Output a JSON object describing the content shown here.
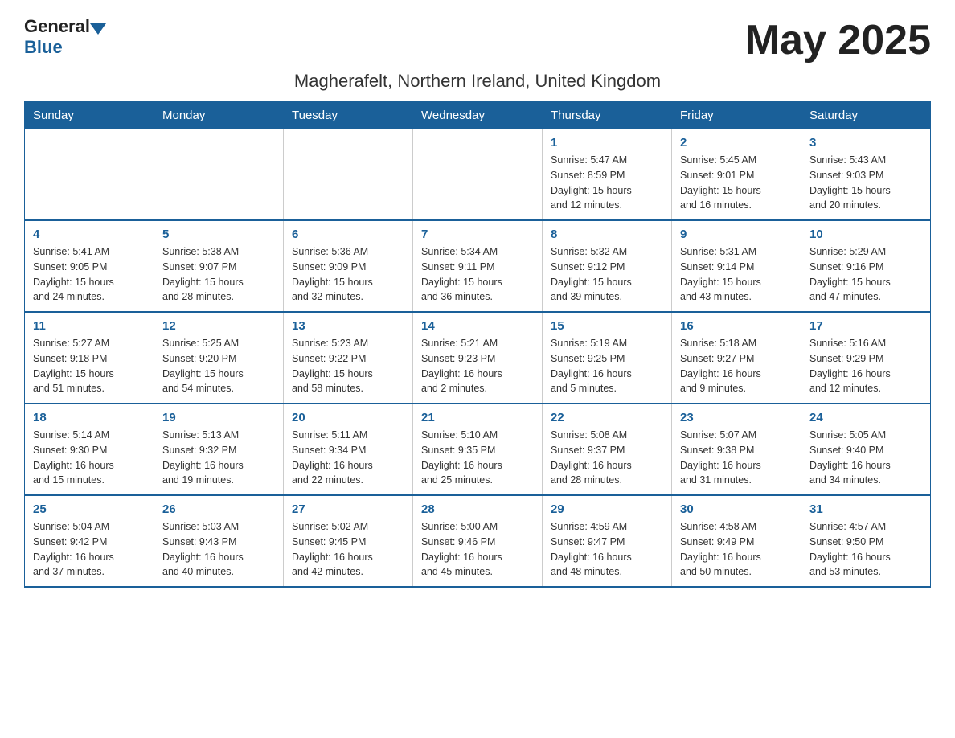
{
  "header": {
    "logo_general": "General",
    "logo_blue": "Blue",
    "month_title": "May 2025",
    "location": "Magherafelt, Northern Ireland, United Kingdom"
  },
  "weekdays": [
    "Sunday",
    "Monday",
    "Tuesday",
    "Wednesday",
    "Thursday",
    "Friday",
    "Saturday"
  ],
  "weeks": [
    [
      {
        "day": "",
        "info": ""
      },
      {
        "day": "",
        "info": ""
      },
      {
        "day": "",
        "info": ""
      },
      {
        "day": "",
        "info": ""
      },
      {
        "day": "1",
        "info": "Sunrise: 5:47 AM\nSunset: 8:59 PM\nDaylight: 15 hours\nand 12 minutes."
      },
      {
        "day": "2",
        "info": "Sunrise: 5:45 AM\nSunset: 9:01 PM\nDaylight: 15 hours\nand 16 minutes."
      },
      {
        "day": "3",
        "info": "Sunrise: 5:43 AM\nSunset: 9:03 PM\nDaylight: 15 hours\nand 20 minutes."
      }
    ],
    [
      {
        "day": "4",
        "info": "Sunrise: 5:41 AM\nSunset: 9:05 PM\nDaylight: 15 hours\nand 24 minutes."
      },
      {
        "day": "5",
        "info": "Sunrise: 5:38 AM\nSunset: 9:07 PM\nDaylight: 15 hours\nand 28 minutes."
      },
      {
        "day": "6",
        "info": "Sunrise: 5:36 AM\nSunset: 9:09 PM\nDaylight: 15 hours\nand 32 minutes."
      },
      {
        "day": "7",
        "info": "Sunrise: 5:34 AM\nSunset: 9:11 PM\nDaylight: 15 hours\nand 36 minutes."
      },
      {
        "day": "8",
        "info": "Sunrise: 5:32 AM\nSunset: 9:12 PM\nDaylight: 15 hours\nand 39 minutes."
      },
      {
        "day": "9",
        "info": "Sunrise: 5:31 AM\nSunset: 9:14 PM\nDaylight: 15 hours\nand 43 minutes."
      },
      {
        "day": "10",
        "info": "Sunrise: 5:29 AM\nSunset: 9:16 PM\nDaylight: 15 hours\nand 47 minutes."
      }
    ],
    [
      {
        "day": "11",
        "info": "Sunrise: 5:27 AM\nSunset: 9:18 PM\nDaylight: 15 hours\nand 51 minutes."
      },
      {
        "day": "12",
        "info": "Sunrise: 5:25 AM\nSunset: 9:20 PM\nDaylight: 15 hours\nand 54 minutes."
      },
      {
        "day": "13",
        "info": "Sunrise: 5:23 AM\nSunset: 9:22 PM\nDaylight: 15 hours\nand 58 minutes."
      },
      {
        "day": "14",
        "info": "Sunrise: 5:21 AM\nSunset: 9:23 PM\nDaylight: 16 hours\nand 2 minutes."
      },
      {
        "day": "15",
        "info": "Sunrise: 5:19 AM\nSunset: 9:25 PM\nDaylight: 16 hours\nand 5 minutes."
      },
      {
        "day": "16",
        "info": "Sunrise: 5:18 AM\nSunset: 9:27 PM\nDaylight: 16 hours\nand 9 minutes."
      },
      {
        "day": "17",
        "info": "Sunrise: 5:16 AM\nSunset: 9:29 PM\nDaylight: 16 hours\nand 12 minutes."
      }
    ],
    [
      {
        "day": "18",
        "info": "Sunrise: 5:14 AM\nSunset: 9:30 PM\nDaylight: 16 hours\nand 15 minutes."
      },
      {
        "day": "19",
        "info": "Sunrise: 5:13 AM\nSunset: 9:32 PM\nDaylight: 16 hours\nand 19 minutes."
      },
      {
        "day": "20",
        "info": "Sunrise: 5:11 AM\nSunset: 9:34 PM\nDaylight: 16 hours\nand 22 minutes."
      },
      {
        "day": "21",
        "info": "Sunrise: 5:10 AM\nSunset: 9:35 PM\nDaylight: 16 hours\nand 25 minutes."
      },
      {
        "day": "22",
        "info": "Sunrise: 5:08 AM\nSunset: 9:37 PM\nDaylight: 16 hours\nand 28 minutes."
      },
      {
        "day": "23",
        "info": "Sunrise: 5:07 AM\nSunset: 9:38 PM\nDaylight: 16 hours\nand 31 minutes."
      },
      {
        "day": "24",
        "info": "Sunrise: 5:05 AM\nSunset: 9:40 PM\nDaylight: 16 hours\nand 34 minutes."
      }
    ],
    [
      {
        "day": "25",
        "info": "Sunrise: 5:04 AM\nSunset: 9:42 PM\nDaylight: 16 hours\nand 37 minutes."
      },
      {
        "day": "26",
        "info": "Sunrise: 5:03 AM\nSunset: 9:43 PM\nDaylight: 16 hours\nand 40 minutes."
      },
      {
        "day": "27",
        "info": "Sunrise: 5:02 AM\nSunset: 9:45 PM\nDaylight: 16 hours\nand 42 minutes."
      },
      {
        "day": "28",
        "info": "Sunrise: 5:00 AM\nSunset: 9:46 PM\nDaylight: 16 hours\nand 45 minutes."
      },
      {
        "day": "29",
        "info": "Sunrise: 4:59 AM\nSunset: 9:47 PM\nDaylight: 16 hours\nand 48 minutes."
      },
      {
        "day": "30",
        "info": "Sunrise: 4:58 AM\nSunset: 9:49 PM\nDaylight: 16 hours\nand 50 minutes."
      },
      {
        "day": "31",
        "info": "Sunrise: 4:57 AM\nSunset: 9:50 PM\nDaylight: 16 hours\nand 53 minutes."
      }
    ]
  ]
}
